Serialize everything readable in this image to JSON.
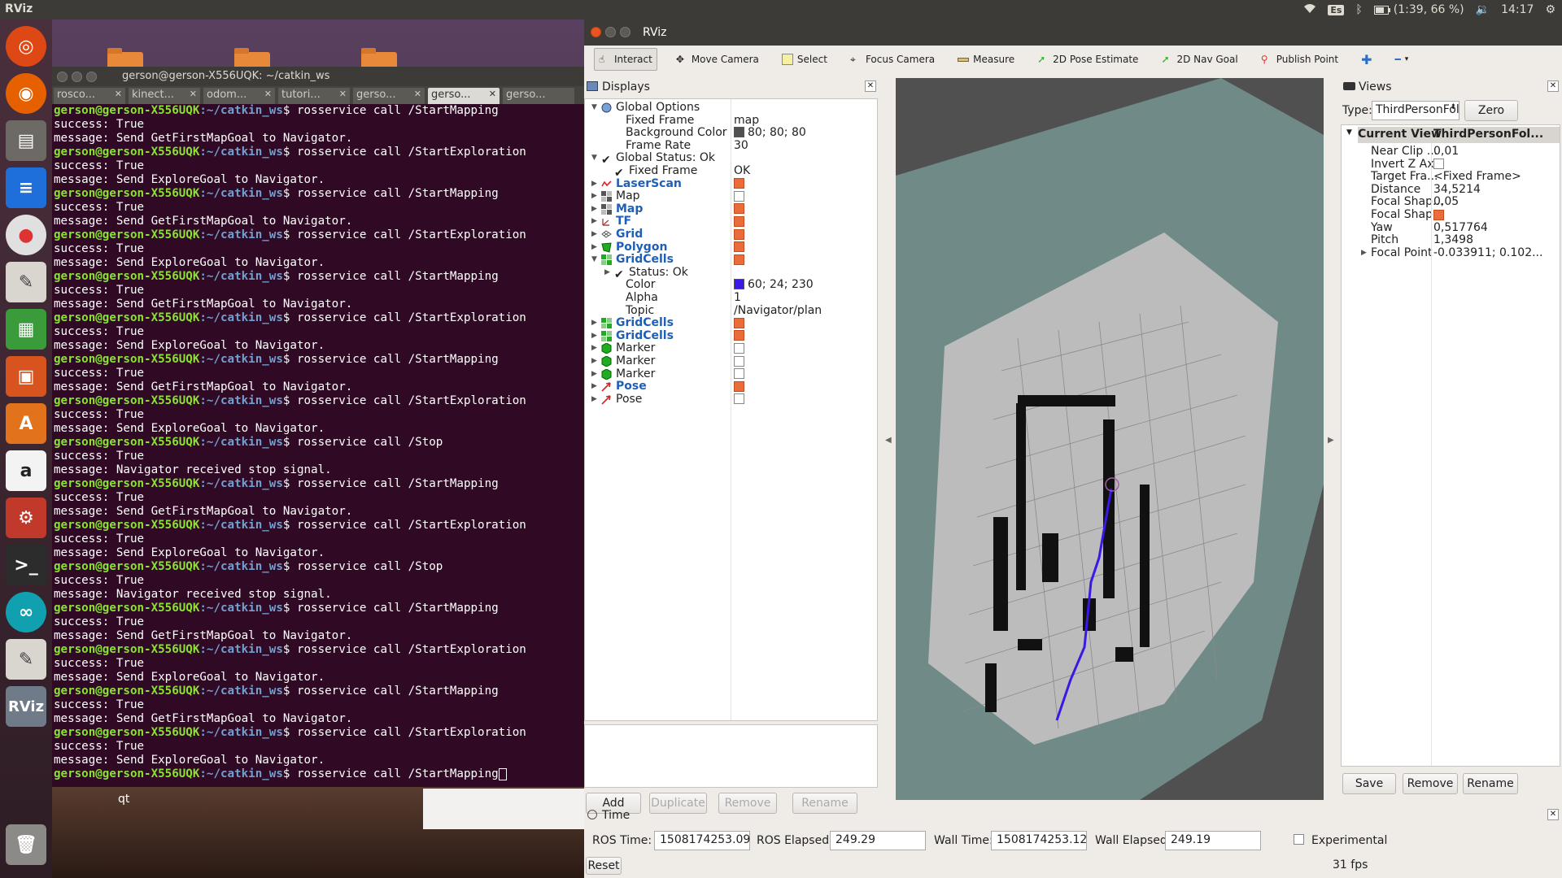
{
  "topbar": {
    "app": "RViz",
    "keyboard": "Es",
    "battery": "(1:39, 66 %)",
    "clock": "14:17"
  },
  "terminal": {
    "title": "gerson@gerson-X556UQK: ~/catkin_ws",
    "tabs": [
      "rosco...",
      "kinect...",
      "odom...",
      "tutori...",
      "gerso...",
      "gerso...",
      "gerso..."
    ],
    "prompt": "gerson@gerson-X556UQK",
    "path": ":~/catkin_ws",
    "lines": [
      {
        "cmd": "rosservice call /StartMapping"
      },
      {
        "out": "success: True"
      },
      {
        "out": "message: Send GetFirstMapGoal to Navigator."
      },
      {
        "cmd": "rosservice call /StartExploration"
      },
      {
        "out": "success: True"
      },
      {
        "out": "message: Send ExploreGoal to Navigator."
      },
      {
        "cmd": "rosservice call /StartMapping"
      },
      {
        "out": "success: True"
      },
      {
        "out": "message: Send GetFirstMapGoal to Navigator."
      },
      {
        "cmd": "rosservice call /StartExploration"
      },
      {
        "out": "success: True"
      },
      {
        "out": "message: Send ExploreGoal to Navigator."
      },
      {
        "cmd": "rosservice call /StartMapping"
      },
      {
        "out": "success: True"
      },
      {
        "out": "message: Send GetFirstMapGoal to Navigator."
      },
      {
        "cmd": "rosservice call /StartExploration"
      },
      {
        "out": "success: True"
      },
      {
        "out": "message: Send ExploreGoal to Navigator."
      },
      {
        "cmd": "rosservice call /StartMapping"
      },
      {
        "out": "success: True"
      },
      {
        "out": "message: Send GetFirstMapGoal to Navigator."
      },
      {
        "cmd": "rosservice call /StartExploration"
      },
      {
        "out": "success: True"
      },
      {
        "out": "message: Send ExploreGoal to Navigator."
      },
      {
        "cmd": "rosservice call /Stop"
      },
      {
        "out": "success: True"
      },
      {
        "out": "message: Navigator received stop signal."
      },
      {
        "cmd": "rosservice call /StartMapping"
      },
      {
        "out": "success: True"
      },
      {
        "out": "message: Send GetFirstMapGoal to Navigator."
      },
      {
        "cmd": "rosservice call /StartExploration"
      },
      {
        "out": "success: True"
      },
      {
        "out": "message: Send ExploreGoal to Navigator."
      },
      {
        "cmd": "rosservice call /Stop"
      },
      {
        "out": "success: True"
      },
      {
        "out": "message: Navigator received stop signal."
      },
      {
        "cmd": "rosservice call /StartMapping"
      },
      {
        "out": "success: True"
      },
      {
        "out": "message: Send GetFirstMapGoal to Navigator."
      },
      {
        "cmd": "rosservice call /StartExploration"
      },
      {
        "out": "success: True"
      },
      {
        "out": "message: Send ExploreGoal to Navigator."
      },
      {
        "cmd": "rosservice call /StartMapping"
      },
      {
        "out": "success: True"
      },
      {
        "out": "message: Send GetFirstMapGoal to Navigator."
      },
      {
        "cmd": "rosservice call /StartExploration"
      },
      {
        "out": "success: True"
      },
      {
        "out": "message: Send ExploreGoal to Navigator."
      },
      {
        "cmd": "rosservice call /StartMapping",
        "cursor": true
      }
    ]
  },
  "desktop": {
    "qt_label": "qt"
  },
  "rviz": {
    "title": "RViz",
    "toolbar": [
      "Interact",
      "Move Camera",
      "Select",
      "Focus Camera",
      "Measure",
      "2D Pose Estimate",
      "2D Nav Goal",
      "Publish Point"
    ],
    "displays": {
      "header": "Displays",
      "rows": [
        {
          "name": "Global Options",
          "icon": "globe-icon",
          "arrow": "▼",
          "indent": 0
        },
        {
          "name": "Fixed Frame",
          "value": "map",
          "indent": 1
        },
        {
          "name": "Background Color",
          "value": "80; 80; 80",
          "swatch": "#505050",
          "indent": 1
        },
        {
          "name": "Frame Rate",
          "value": "30",
          "indent": 1
        },
        {
          "name": "Global Status: Ok",
          "icon": "check-icon",
          "arrow": "▼",
          "indent": 0
        },
        {
          "name": "Fixed Frame",
          "value": "OK",
          "icon": "check-icon",
          "indent": 1
        },
        {
          "name": "LaserScan",
          "icon": "laserscan-icon",
          "arrow": "▶",
          "blue": true,
          "check": true,
          "indent": 0
        },
        {
          "name": "Map",
          "icon": "map-icon",
          "arrow": "▶",
          "check": false,
          "indent": 0
        },
        {
          "name": "Map",
          "icon": "map-icon",
          "arrow": "▶",
          "blue": true,
          "check": true,
          "indent": 0
        },
        {
          "name": "TF",
          "icon": "tf-icon",
          "arrow": "▶",
          "blue": true,
          "check": true,
          "indent": 0
        },
        {
          "name": "Grid",
          "icon": "grid-icon",
          "arrow": "▶",
          "blue": true,
          "check": true,
          "indent": 0
        },
        {
          "name": "Polygon",
          "icon": "polygon-icon",
          "arrow": "▶",
          "blue": true,
          "check": true,
          "indent": 0
        },
        {
          "name": "GridCells",
          "icon": "gridcells-icon",
          "arrow": "▼",
          "blue": true,
          "check": true,
          "indent": 0
        },
        {
          "name": "Status: Ok",
          "icon": "check-icon",
          "arrow": "▶",
          "indent": 1
        },
        {
          "name": "Color",
          "value": "60; 24; 230",
          "swatch": "#3c18e6",
          "indent": 1
        },
        {
          "name": "Alpha",
          "value": "1",
          "indent": 1
        },
        {
          "name": "Topic",
          "value": "/Navigator/plan",
          "indent": 1
        },
        {
          "name": "GridCells",
          "icon": "gridcells-icon",
          "arrow": "▶",
          "blue": true,
          "check": true,
          "indent": 0
        },
        {
          "name": "GridCells",
          "icon": "gridcells-icon",
          "arrow": "▶",
          "blue": true,
          "check": true,
          "indent": 0
        },
        {
          "name": "Marker",
          "icon": "marker-icon",
          "arrow": "▶",
          "check": false,
          "indent": 0
        },
        {
          "name": "Marker",
          "icon": "marker-icon",
          "arrow": "▶",
          "check": false,
          "indent": 0
        },
        {
          "name": "Marker",
          "icon": "marker-icon",
          "arrow": "▶",
          "check": false,
          "indent": 0
        },
        {
          "name": "Pose",
          "icon": "pose-icon",
          "arrow": "▶",
          "blue": true,
          "check": true,
          "indent": 0
        },
        {
          "name": "Pose",
          "icon": "pose-icon",
          "arrow": "▶",
          "check": false,
          "indent": 0
        }
      ],
      "buttons": {
        "add": "Add",
        "duplicate": "Duplicate",
        "remove": "Remove",
        "rename": "Rename"
      }
    },
    "views": {
      "header": "Views",
      "type_label": "Type:",
      "type_value": "ThirdPersonFoll",
      "zero": "Zero",
      "col1": "Current View",
      "col2": "ThirdPersonFol...",
      "rows": [
        {
          "name": "Near Clip ...",
          "value": "0,01"
        },
        {
          "name": "Invert Z Axis",
          "check": false
        },
        {
          "name": "Target Fra...",
          "value": "<Fixed Frame>"
        },
        {
          "name": "Distance",
          "value": "34,5214"
        },
        {
          "name": "Focal Shap...",
          "value": "0,05"
        },
        {
          "name": "Focal Shap...",
          "check": true
        },
        {
          "name": "Yaw",
          "value": "0,517764"
        },
        {
          "name": "Pitch",
          "value": "1,3498"
        },
        {
          "name": "Focal Point",
          "value": "-0.033911; 0.102...",
          "arrow": "▶"
        }
      ],
      "buttons": {
        "save": "Save",
        "remove": "Remove",
        "rename": "Rename"
      }
    },
    "time": {
      "header": "Time",
      "ros_time_label": "ROS Time:",
      "ros_time": "1508174253.09",
      "ros_elapsed_label": "ROS Elapsed:",
      "ros_elapsed": "249.29",
      "wall_time_label": "Wall Time:",
      "wall_time": "1508174253.12",
      "wall_elapsed_label": "Wall Elapsed:",
      "wall_elapsed": "249.19",
      "experimental": "Experimental",
      "reset": "Reset",
      "fps": "31 fps"
    }
  }
}
